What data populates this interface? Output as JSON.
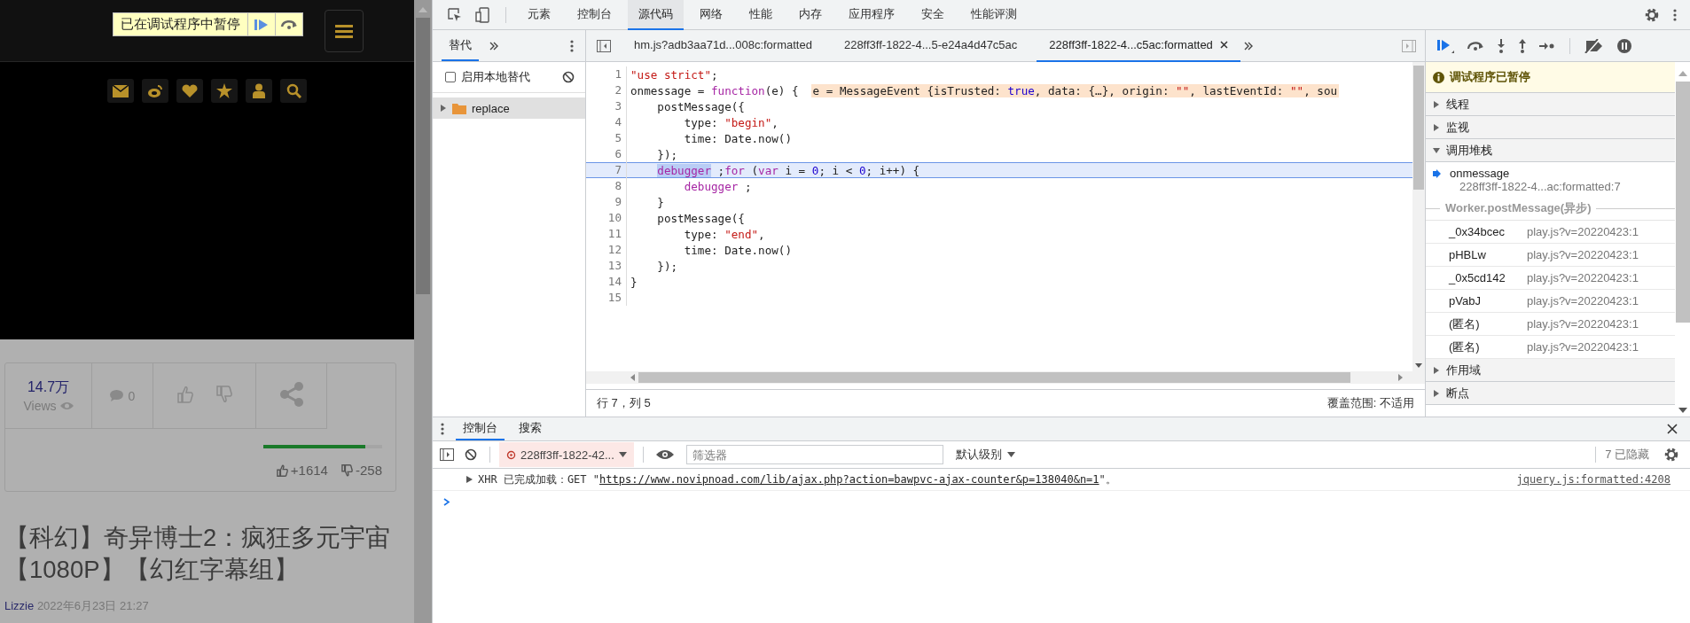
{
  "page": {
    "paused_overlay": {
      "text": "已在调试程序中暂停"
    },
    "stats": {
      "views": "14.7万",
      "views_label": "Views",
      "comments": "0",
      "level": 0.86,
      "likes": "+1614",
      "dislikes": "-258"
    },
    "title": "【科幻】奇异博士2：疯狂多元宇宙【1080P】【幻红字幕组】",
    "author": "Lizzie",
    "date": "2022年6月23日 21:27"
  },
  "devtools": {
    "tabs": [
      {
        "label": "元素",
        "selected": false
      },
      {
        "label": "控制台",
        "selected": false
      },
      {
        "label": "源代码",
        "selected": true
      },
      {
        "label": "网络",
        "selected": false
      },
      {
        "label": "性能",
        "selected": false
      },
      {
        "label": "内存",
        "selected": false
      },
      {
        "label": "应用程序",
        "selected": false
      },
      {
        "label": "安全",
        "selected": false
      },
      {
        "label": "性能评测",
        "selected": false
      }
    ],
    "navigator": {
      "tabs": [
        {
          "label": "替代",
          "selected": true
        }
      ],
      "override": {
        "label": "启用本地替代",
        "checked": false
      },
      "tree": [
        {
          "label": "replace",
          "selected": true,
          "expanded": false
        }
      ]
    },
    "editor_tabs": [
      {
        "label": "hm.js?adb3aa71d...008c:formatted",
        "selected": false,
        "closable": false
      },
      {
        "label": "228ff3ff-1822-4...5-e24a4d47c5ac",
        "selected": false,
        "closable": false
      },
      {
        "label": "228ff3ff-1822-4...c5ac:formatted",
        "selected": true,
        "closable": true
      }
    ],
    "code": [
      {
        "n": "1",
        "selected": false,
        "tokens": [
          {
            "t": "\"use strict\"",
            "kind": "str"
          },
          {
            "t": ";",
            "kind": "plain"
          }
        ]
      },
      {
        "n": "2",
        "selected": false,
        "tokens": [
          {
            "t": "onmessage = ",
            "kind": "plain"
          },
          {
            "t": "function",
            "kind": "kw"
          },
          {
            "t": "(e) {",
            "kind": "plain"
          }
        ],
        "inline": [
          {
            "t": "e = MessageEvent {isTrusted: ",
            "kind": "plain"
          },
          {
            "t": "true",
            "kind": "num"
          },
          {
            "t": ", data: {…}, origin: ",
            "kind": "plain"
          },
          {
            "t": "\"\"",
            "kind": "str"
          },
          {
            "t": ", lastEventId: ",
            "kind": "plain"
          },
          {
            "t": "\"\"",
            "kind": "str"
          },
          {
            "t": ", sou",
            "kind": "plain"
          }
        ]
      },
      {
        "n": "3",
        "selected": false,
        "tokens": [
          {
            "t": "    postMessage({",
            "kind": "plain"
          }
        ]
      },
      {
        "n": "4",
        "selected": false,
        "tokens": [
          {
            "t": "        type: ",
            "kind": "plain"
          },
          {
            "t": "\"begin\"",
            "kind": "str"
          },
          {
            "t": ",",
            "kind": "plain"
          }
        ]
      },
      {
        "n": "5",
        "selected": false,
        "tokens": [
          {
            "t": "        time: Date.now()",
            "kind": "plain"
          }
        ]
      },
      {
        "n": "6",
        "selected": false,
        "tokens": [
          {
            "t": "    });",
            "kind": "plain"
          }
        ]
      },
      {
        "n": "7",
        "selected": true,
        "tokens": [
          {
            "t": "    debugger",
            "kind": "current"
          },
          {
            "t": " ;",
            "kind": "plain"
          },
          {
            "t": "for",
            "kind": "kw"
          },
          {
            "t": " (",
            "kind": "plain"
          },
          {
            "t": "var",
            "kind": "kw"
          },
          {
            "t": " i = ",
            "kind": "plain"
          },
          {
            "t": "0",
            "kind": "num"
          },
          {
            "t": "; i < ",
            "kind": "plain"
          },
          {
            "t": "0",
            "kind": "num"
          },
          {
            "t": "; i++) {",
            "kind": "plain"
          }
        ]
      },
      {
        "n": "8",
        "selected": false,
        "tokens": [
          {
            "t": "        debugger",
            "kind": "kw"
          },
          {
            "t": " ;",
            "kind": "plain"
          }
        ]
      },
      {
        "n": "9",
        "selected": false,
        "tokens": [
          {
            "t": "    }",
            "kind": "plain"
          }
        ]
      },
      {
        "n": "10",
        "selected": false,
        "tokens": [
          {
            "t": "    postMessage({",
            "kind": "plain"
          }
        ]
      },
      {
        "n": "11",
        "selected": false,
        "tokens": [
          {
            "t": "        type: ",
            "kind": "plain"
          },
          {
            "t": "\"end\"",
            "kind": "str"
          },
          {
            "t": ",",
            "kind": "plain"
          }
        ]
      },
      {
        "n": "12",
        "selected": false,
        "tokens": [
          {
            "t": "        time: Date.now()",
            "kind": "plain"
          }
        ]
      },
      {
        "n": "13",
        "selected": false,
        "tokens": [
          {
            "t": "    });",
            "kind": "plain"
          }
        ]
      },
      {
        "n": "14",
        "selected": false,
        "tokens": [
          {
            "t": "}",
            "kind": "plain"
          }
        ]
      },
      {
        "n": "15",
        "selected": false
      }
    ],
    "status": {
      "position": "行 7，列 5",
      "coverage": "覆盖范围: 不适用"
    },
    "debugger": {
      "paused_message": "调试程序已暂停",
      "sections": [
        {
          "label": "线程",
          "expanded": false
        },
        {
          "label": "监视",
          "expanded": false
        },
        {
          "label": "调用堆栈",
          "expanded": true,
          "frames": [
            {
              "name": "onmessage",
              "location": "228ff3ff-1822-4...ac:formatted:7",
              "selected": true
            }
          ],
          "async_label": "Worker.postMessage(异步)",
          "async_frames": [
            {
              "name": "_0x34bcec",
              "location": "play.js?v=20220423:1"
            },
            {
              "name": "pHBLw",
              "location": "play.js?v=20220423:1"
            },
            {
              "name": "_0x5cd142",
              "location": "play.js?v=20220423:1"
            },
            {
              "name": "pVabJ",
              "location": "play.js?v=20220423:1"
            },
            {
              "name": "(匿名)",
              "location": "play.js?v=20220423:1"
            },
            {
              "name": "(匿名)",
              "location": "play.js?v=20220423:1"
            }
          ]
        },
        {
          "label": "作用域",
          "expanded": false
        },
        {
          "label": "断点",
          "expanded": false
        }
      ]
    },
    "drawer": {
      "tabs": [
        {
          "label": "控制台",
          "selected": true
        },
        {
          "label": "搜索",
          "selected": false
        }
      ],
      "context": "228ff3ff-1822-42...",
      "filter_placeholder": "筛选器",
      "level": "默认级别",
      "hidden": "7 已隐藏",
      "messages": [
        {
          "expanded": false,
          "prefix": "XHR 已完成加载：GET \"",
          "url": "https://www.novipnoad.com/lib/ajax.php?action=bawpvc-ajax-counter&p=138040&n=1",
          "suffix": "\"。",
          "source": "jquery.js:formatted:4208"
        }
      ]
    }
  }
}
